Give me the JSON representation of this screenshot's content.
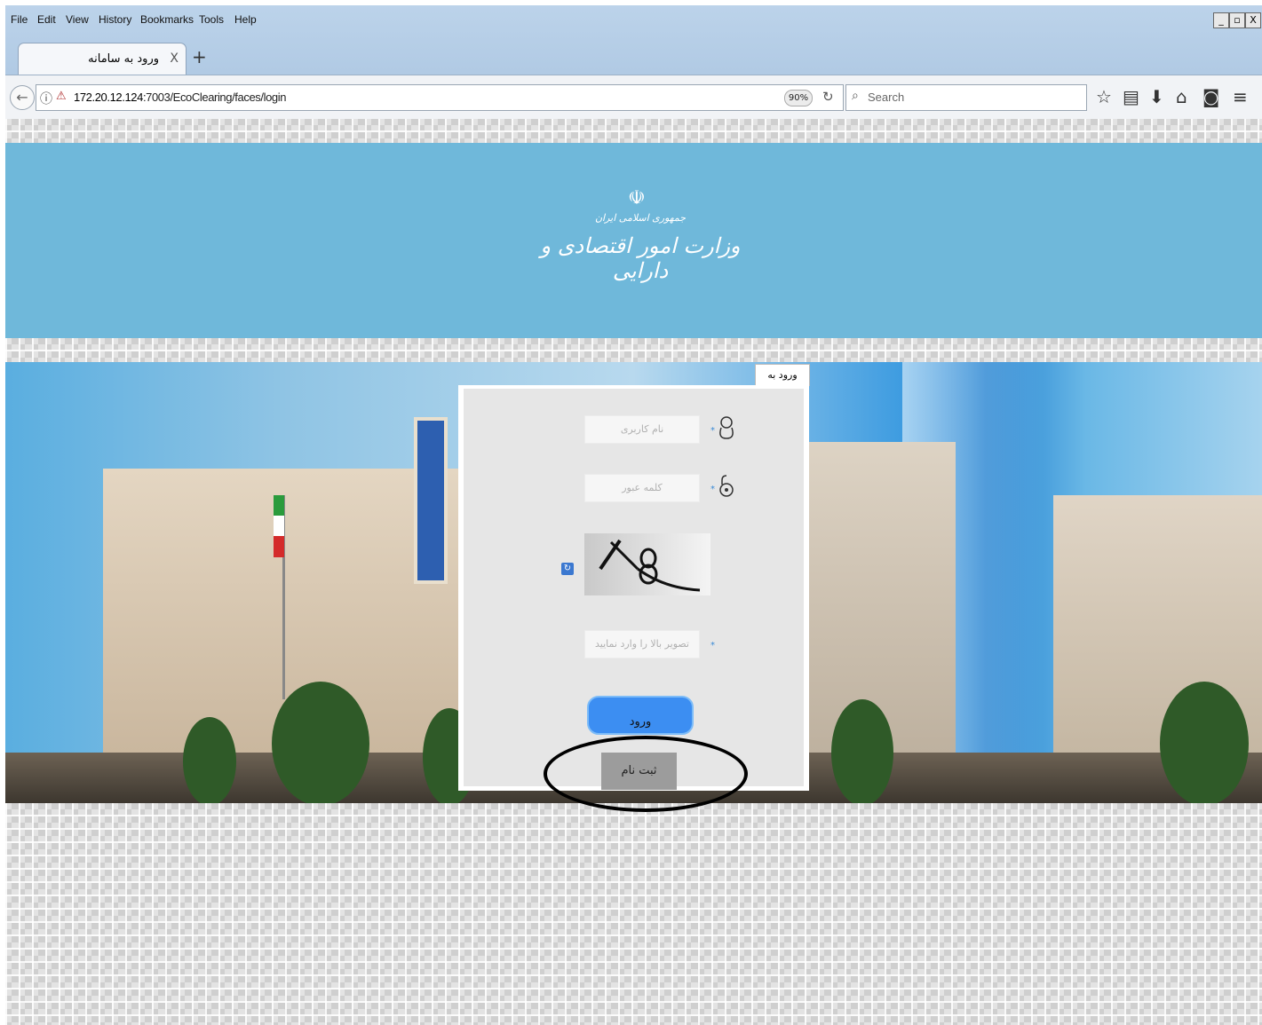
{
  "menu": {
    "file": "File",
    "edit": "Edit",
    "view": "View",
    "history": "History",
    "bookmarks": "Bookmarks",
    "tools": "Tools",
    "help": "Help"
  },
  "window_controls": {
    "minimize": "_",
    "maximize": "▫",
    "close": "X"
  },
  "tab": {
    "title": "ورود به سامانه",
    "close": "X",
    "new_tab": "+"
  },
  "address_bar": {
    "host": "172.20.12.124",
    "path": ":7003/EcoClearing/faces/login",
    "zoom": "90%"
  },
  "search": {
    "placeholder": "Search"
  },
  "toolbar_icons": [
    "star-icon",
    "reading-list-icon",
    "download-icon",
    "home-icon",
    "pocket-icon",
    "menu-icon"
  ],
  "banner": {
    "emblem": "☫",
    "sub": "جمهوری اسلامی ایران",
    "title": "وزارت امور اقتصادی و دارایی"
  },
  "login": {
    "tab_label": "ورود به سامانه",
    "username_placeholder": "نام کاربری",
    "password_placeholder": "کلمه عبور",
    "captcha_placeholder": "تصویر بالا را وارد نمایید",
    "required_mark": "*",
    "login_button": "ورود",
    "register_button": "ثبت نام"
  },
  "colors": {
    "banner": "#6fb8da",
    "login_button": "#3c8ef2",
    "register_button": "#9c9c9c",
    "annotation": "#000000"
  }
}
